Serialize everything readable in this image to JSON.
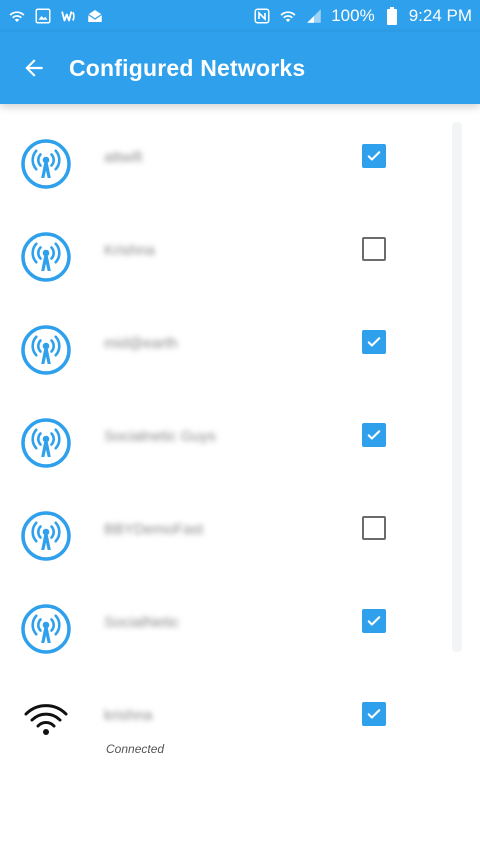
{
  "status_bar": {
    "battery_text": "100%",
    "time": "9:24 PM",
    "icons_left": [
      "wifi-icon",
      "image-icon",
      "w-app-icon",
      "mail-icon"
    ],
    "icons_right": [
      "nfc-icon",
      "wifi-icon",
      "signal-icon",
      "battery-icon"
    ]
  },
  "app_bar": {
    "title": "Configured Networks",
    "back_icon": "arrow-left-icon"
  },
  "colors": {
    "primary": "#2ea0ec",
    "network_icon": "#2ea0ec",
    "checkbox_checked": "#2ea0ec"
  },
  "networks": [
    {
      "name": "attwifi",
      "checked": true,
      "icon": "wifi-hotspot-icon"
    },
    {
      "name": "Krishna",
      "checked": false,
      "icon": "wifi-hotspot-icon"
    },
    {
      "name": "mid@earth",
      "checked": true,
      "icon": "wifi-hotspot-icon"
    },
    {
      "name": "Socialnetic Guys",
      "checked": true,
      "icon": "wifi-hotspot-icon"
    },
    {
      "name": "BBYDemoFast",
      "checked": false,
      "icon": "wifi-hotspot-icon"
    },
    {
      "name": "SocialNetic",
      "checked": true,
      "icon": "wifi-hotspot-icon"
    },
    {
      "name": "krishna",
      "checked": true,
      "icon": "wifi-icon",
      "status": "Connected"
    }
  ]
}
